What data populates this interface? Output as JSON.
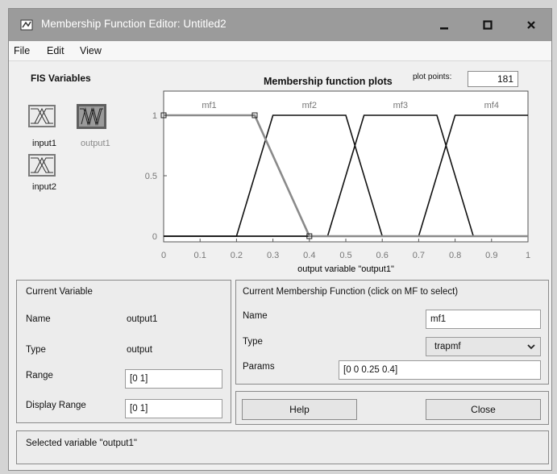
{
  "window": {
    "title": "Membership Function Editor: Untitled2"
  },
  "menu": {
    "file": "File",
    "edit": "Edit",
    "view": "View"
  },
  "fis": {
    "title": "FIS Variables",
    "vars": {
      "input1": "input1",
      "output1": "output1",
      "input2": "input2"
    }
  },
  "plot": {
    "title": "Membership function plots",
    "plot_points_label": "plot points:",
    "plot_points_value": "181",
    "xlabel": "output variable \"output1\"",
    "mf_labels": [
      "mf1",
      "mf2",
      "mf3",
      "mf4"
    ]
  },
  "chart_data": {
    "type": "line",
    "xlabel": "output variable \"output1\"",
    "xlim": [
      0,
      1
    ],
    "ylim": [
      0,
      1
    ],
    "xticks": [
      "0",
      "0.1",
      "0.2",
      "0.3",
      "0.4",
      "0.5",
      "0.6",
      "0.7",
      "0.8",
      "0.9",
      "1"
    ],
    "yticks": [
      "0",
      "0.5",
      "1"
    ],
    "series": [
      {
        "name": "mf1",
        "selected": true,
        "x": [
          0,
          0,
          0.25,
          0.4,
          1
        ],
        "y": [
          1,
          1,
          1,
          0,
          0
        ]
      },
      {
        "name": "mf2",
        "x": [
          0,
          0.2,
          0.3,
          0.5,
          0.6,
          1
        ],
        "y": [
          0,
          0,
          1,
          1,
          0,
          0
        ]
      },
      {
        "name": "mf3",
        "x": [
          0,
          0.45,
          0.55,
          0.75,
          0.85,
          1
        ],
        "y": [
          0,
          0,
          1,
          1,
          0,
          0
        ]
      },
      {
        "name": "mf4",
        "x": [
          0,
          0.7,
          0.8,
          1,
          1
        ],
        "y": [
          0,
          0,
          1,
          1,
          1
        ]
      }
    ]
  },
  "current_variable": {
    "header": "Current Variable",
    "name_label": "Name",
    "name_value": "output1",
    "type_label": "Type",
    "type_value": "output",
    "range_label": "Range",
    "range_value": "[0 1]",
    "display_range_label": "Display Range",
    "display_range_value": "[0 1]"
  },
  "current_mf": {
    "header": "Current Membership Function (click on MF to select)",
    "name_label": "Name",
    "name_value": "mf1",
    "type_label": "Type",
    "type_value": "trapmf",
    "params_label": "Params",
    "params_value": "[0 0 0.25 0.4]"
  },
  "buttons": {
    "help": "Help",
    "close": "Close"
  },
  "status": "Selected variable \"output1\""
}
